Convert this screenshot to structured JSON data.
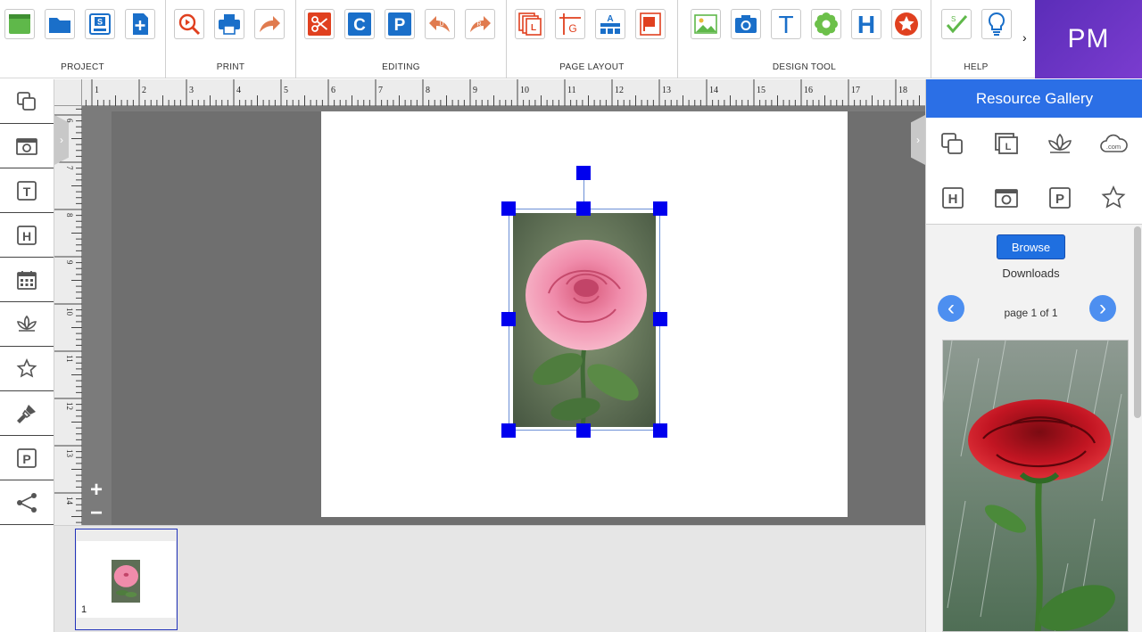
{
  "app": {
    "brand": "PM"
  },
  "ribbon": {
    "groups": [
      {
        "label": "PROJECT"
      },
      {
        "label": "PRINT"
      },
      {
        "label": "EDITING"
      },
      {
        "label": "PAGE LAYOUT"
      },
      {
        "label": "DESIGN TOOL"
      },
      {
        "label": "HELP"
      }
    ],
    "more_arrow": "›",
    "design_text_glyph": "T",
    "design_heading_glyph": "H",
    "editing_copy_glyph": "C",
    "editing_paste_glyph": "P"
  },
  "lefttools": [
    {
      "icon": "layers-icon"
    },
    {
      "icon": "photo-frame-icon"
    },
    {
      "icon": "text-box-icon",
      "glyph": "T"
    },
    {
      "icon": "heading-box-icon",
      "glyph": "H"
    },
    {
      "icon": "calendar-icon"
    },
    {
      "icon": "lotus-icon"
    },
    {
      "icon": "star-outline-icon"
    },
    {
      "icon": "brush-icon"
    },
    {
      "icon": "paste-box-icon",
      "glyph": "P"
    },
    {
      "icon": "share-icon"
    }
  ],
  "workspace": {
    "ruler_top_labels": [
      "1",
      "2",
      "3",
      "4",
      "5",
      "6",
      "7",
      "8",
      "9",
      "10",
      "11",
      "12",
      "13",
      "14",
      "15",
      "16",
      "17",
      "18"
    ],
    "ruler_left_labels": [
      "6",
      "7",
      "8",
      "9",
      "10",
      "11",
      "12",
      "13",
      "14"
    ],
    "zoom_in": "+",
    "zoom_out": "−"
  },
  "strip": {
    "thumb_number": "1"
  },
  "gallery": {
    "title": "Resource Gallery",
    "icon_glyphs": {
      "heading": "H",
      "paste": "P",
      "dotcom": ".com"
    },
    "browse": "Browse",
    "folder": "Downloads",
    "pager": "page 1 of 1",
    "prev": "‹",
    "next": "›"
  },
  "colors": {
    "accent": "#2b6fe6",
    "handle": "#0000ee",
    "brand": "#6a34c4",
    "icon_blue": "#1a6fc9",
    "icon_red": "#e0401f"
  }
}
